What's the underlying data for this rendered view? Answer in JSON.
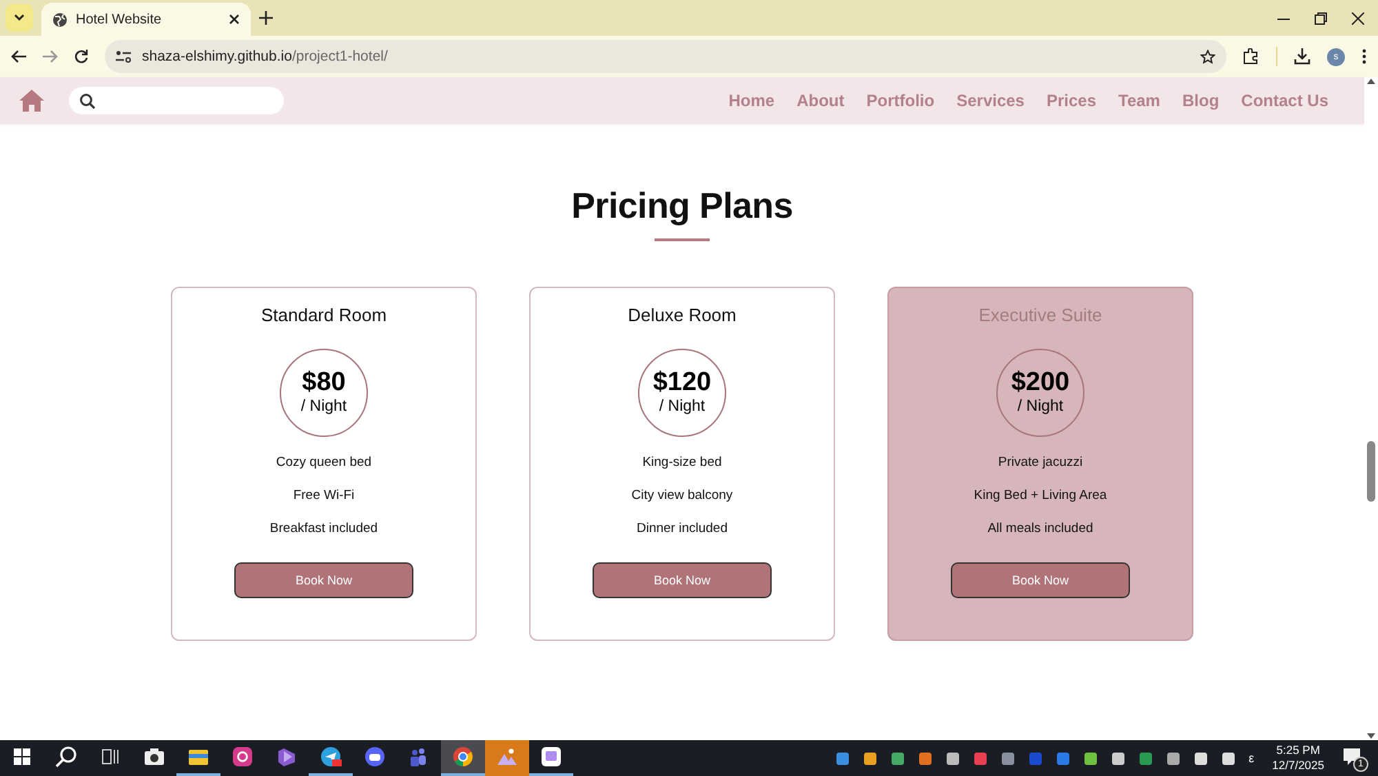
{
  "browser": {
    "tabs": [
      {
        "title": "Hotel Website",
        "selected": true
      }
    ],
    "address": {
      "host": "shaza-elshimy.github.io",
      "path": "/project1-hotel/"
    },
    "profile": "s"
  },
  "site_nav": {
    "links": [
      {
        "label": "Home"
      },
      {
        "label": "About"
      },
      {
        "label": "Portfolio"
      },
      {
        "label": "Services"
      },
      {
        "label": "Prices"
      },
      {
        "label": "Team"
      },
      {
        "label": "Blog"
      },
      {
        "label": "Contact Us"
      }
    ]
  },
  "pricing": {
    "title": "Pricing Plans",
    "plans": [
      {
        "name": "Standard Room",
        "price": "$80",
        "period": "/ Night",
        "features": [
          "Cozy queen bed",
          "Free Wi-Fi",
          "Breakfast included"
        ],
        "button": "Book Now",
        "highlighted": false
      },
      {
        "name": "Deluxe Room",
        "price": "$120",
        "period": "/ Night",
        "features": [
          "King-size bed",
          "City view balcony",
          "Dinner included"
        ],
        "button": "Book Now",
        "highlighted": false
      },
      {
        "name": "Executive Suite",
        "price": "$200",
        "period": "/ Night",
        "features": [
          "Private jacuzzi",
          "King Bed + Living Area",
          "All meals included"
        ],
        "button": "Book Now",
        "highlighted": true
      }
    ]
  },
  "taskbar": {
    "apps": [
      {
        "running": false,
        "selected": false,
        "attention": false
      },
      {
        "running": true,
        "selected": false,
        "attention": false
      },
      {
        "running": false,
        "selected": false,
        "attention": false
      },
      {
        "running": false,
        "selected": false,
        "attention": false
      },
      {
        "running": true,
        "selected": false,
        "attention": false
      },
      {
        "running": false,
        "selected": false,
        "attention": false
      },
      {
        "running": false,
        "selected": false,
        "attention": false
      },
      {
        "running": true,
        "selected": true,
        "attention": false
      },
      {
        "running": false,
        "selected": false,
        "attention": true
      },
      {
        "running": true,
        "selected": false,
        "attention": false
      }
    ],
    "language": "ε",
    "time": "5:25 PM",
    "date": "12/7/2025",
    "notifications": "1"
  }
}
